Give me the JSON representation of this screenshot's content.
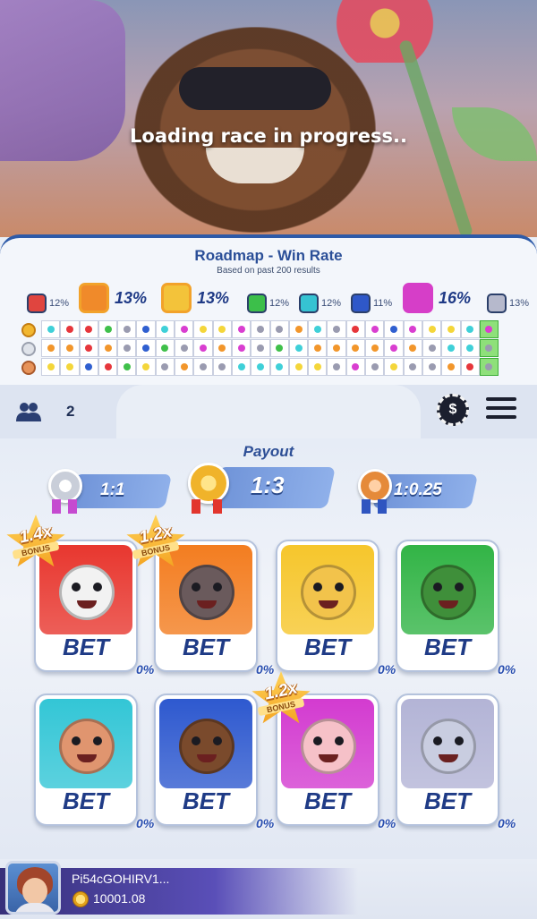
{
  "banner": {
    "loading_text": "Loading race in progress.."
  },
  "roadmap": {
    "title": "Roadmap - Win Rate",
    "subtitle": "Based on past 200 results",
    "win_rates": [
      {
        "racer": "rooster",
        "pct": "12%",
        "color": "#e0453f",
        "highlight": false
      },
      {
        "racer": "dog",
        "pct": "13%",
        "color": "#f08a2a",
        "highlight": true
      },
      {
        "racer": "tiger",
        "pct": "13%",
        "color": "#f3c33a",
        "highlight": true
      },
      {
        "racer": "frog",
        "pct": "12%",
        "color": "#3cbf4a",
        "highlight": false
      },
      {
        "racer": "monkey",
        "pct": "12%",
        "color": "#36c3d2",
        "highlight": false
      },
      {
        "racer": "bear",
        "pct": "11%",
        "color": "#2f58c9",
        "highlight": false
      },
      {
        "racer": "pig",
        "pct": "16%",
        "color": "#d63ec8",
        "highlight": true
      },
      {
        "racer": "cat",
        "pct": "13%",
        "color": "#b6b9cc",
        "highlight": false
      }
    ],
    "rows": [
      [
        "cyan",
        "red",
        "red",
        "green",
        "purple",
        "blue",
        "cyan",
        "magenta",
        "yellow",
        "yellow",
        "magenta",
        "purple",
        "purple",
        "orange",
        "cyan",
        "purple",
        "red",
        "magenta",
        "blue",
        "magenta",
        "yellow",
        "yellow",
        "cyan",
        "magenta"
      ],
      [
        "orange",
        "orange",
        "red",
        "orange",
        "purple",
        "blue",
        "green",
        "purple",
        "magenta",
        "orange",
        "magenta",
        "purple",
        "green",
        "cyan",
        "orange",
        "orange",
        "orange",
        "orange",
        "magenta",
        "orange",
        "purple",
        "cyan",
        "cyan",
        "purple"
      ],
      [
        "yellow",
        "yellow",
        "blue",
        "red",
        "green",
        "yellow",
        "purple",
        "orange",
        "purple",
        "purple",
        "cyan",
        "cyan",
        "cyan",
        "yellow",
        "yellow",
        "purple",
        "magenta",
        "purple",
        "yellow",
        "purple",
        "purple",
        "orange",
        "red",
        "purple"
      ]
    ],
    "dot_colors": {
      "red": "#e6363b",
      "orange": "#f2962b",
      "yellow": "#f4d63a",
      "green": "#3fc04a",
      "cyan": "#3fd0d8",
      "blue": "#2f5fd0",
      "magenta": "#d93ed0",
      "purple": "#9a9bb0"
    }
  },
  "toolbar": {
    "players_count": "2",
    "chip_symbol": "$"
  },
  "payout": {
    "label": "Payout",
    "silver": "1:1",
    "gold": "1:3",
    "bronze": "1:0.25"
  },
  "racers": [
    {
      "name": "rooster",
      "bet_label": "BET",
      "pct": "0%",
      "bg": "#e8372f",
      "face": "#f2f2f2",
      "bonus": "1.4x"
    },
    {
      "name": "dog",
      "bet_label": "BET",
      "pct": "0%",
      "bg": "#f37d20",
      "face": "#6a5a5c",
      "bonus": "1.2x"
    },
    {
      "name": "tiger",
      "bet_label": "BET",
      "pct": "0%",
      "bg": "#f6c62c",
      "face": "#f2c34b",
      "bonus": ""
    },
    {
      "name": "frog",
      "bet_label": "BET",
      "pct": "0%",
      "bg": "#32b446",
      "face": "#3f8f3a",
      "bonus": ""
    },
    {
      "name": "monkey",
      "bet_label": "BET",
      "pct": "0%",
      "bg": "#33c6d6",
      "face": "#e0956f",
      "bonus": ""
    },
    {
      "name": "bear",
      "bet_label": "BET",
      "pct": "0%",
      "bg": "#2e59cf",
      "face": "#7a4a2c",
      "bonus": ""
    },
    {
      "name": "pig",
      "bet_label": "BET",
      "pct": "0%",
      "bg": "#d33bd0",
      "face": "#f6c1c8",
      "bonus": "1.2x"
    },
    {
      "name": "cat",
      "bet_label": "BET",
      "pct": "0%",
      "bg": "#b3b4d6",
      "face": "#c9cde0",
      "bonus": ""
    }
  ],
  "bonus_word": "BONUS",
  "user": {
    "name": "Pi54cGOHIRV1...",
    "balance": "10001.08"
  }
}
